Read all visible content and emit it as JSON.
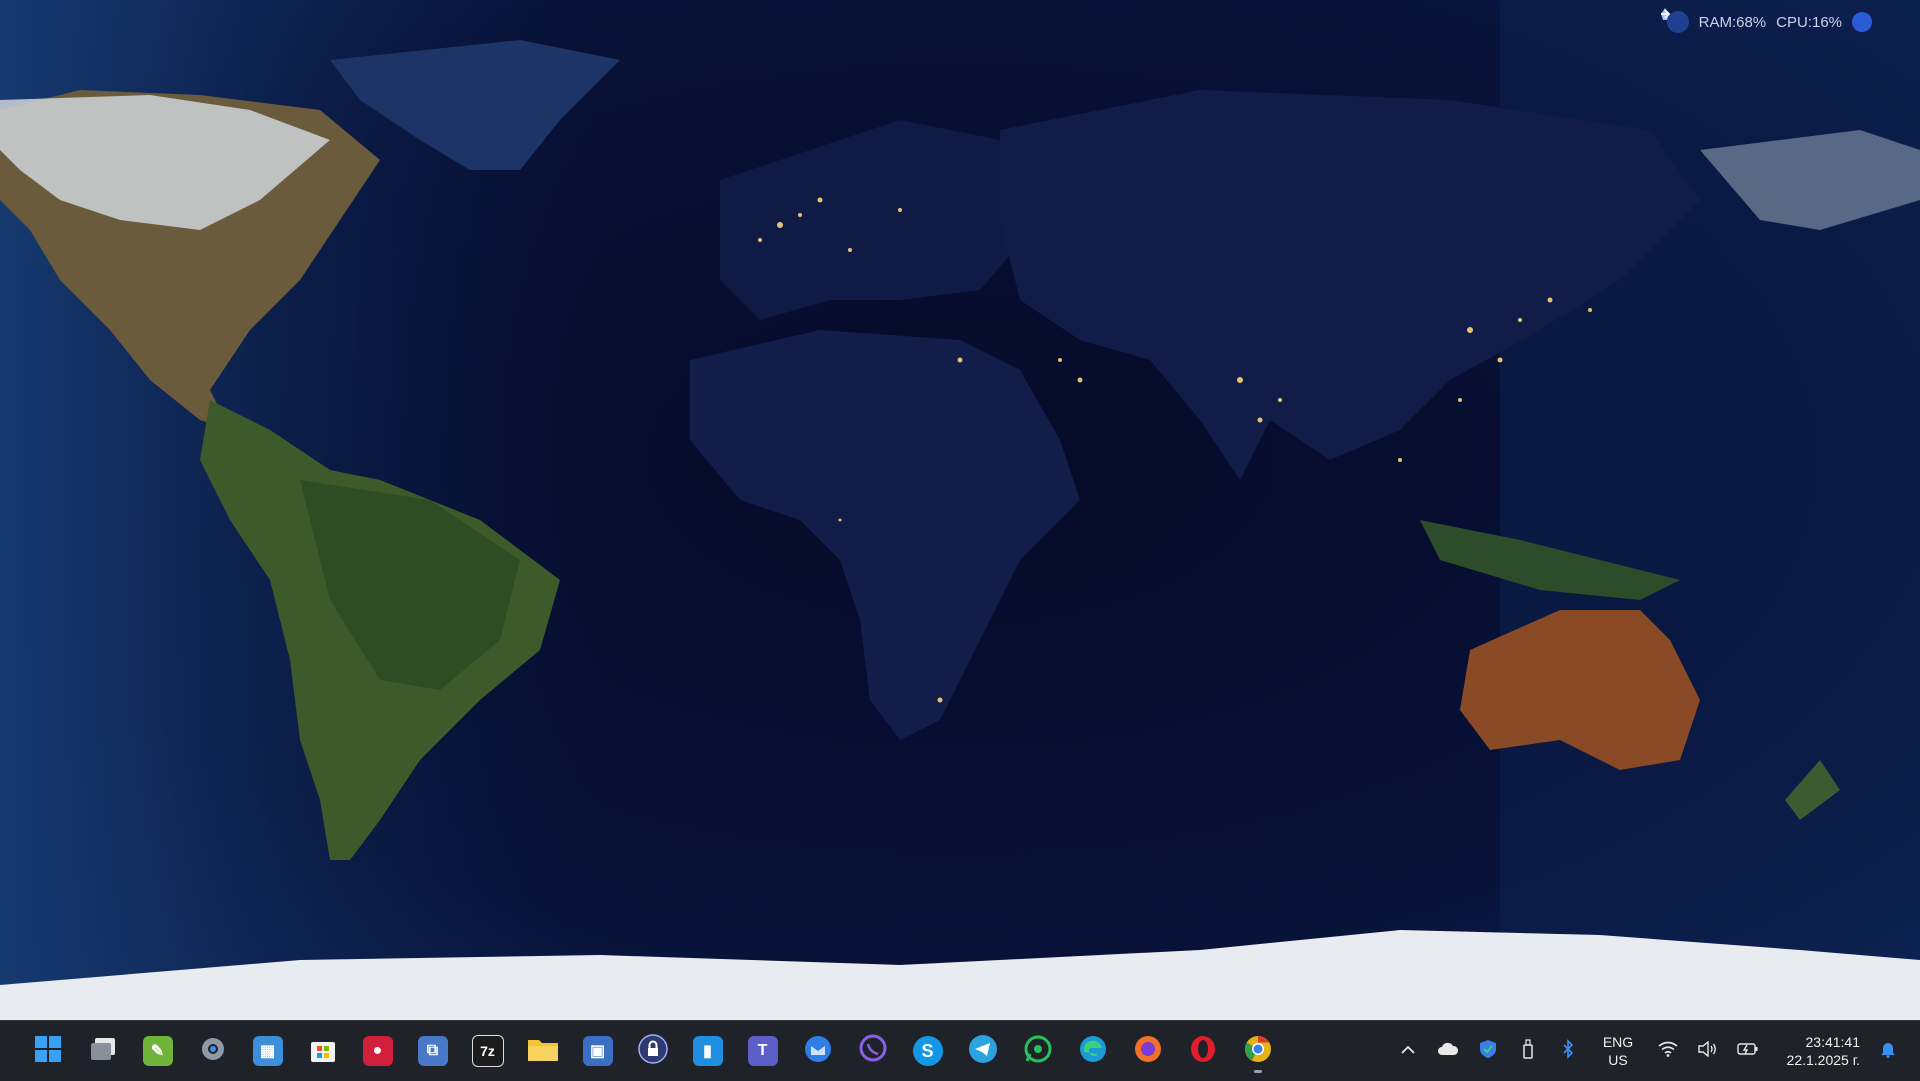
{
  "monitor": {
    "ram": "RAM:68%",
    "cpu": "CPU:16%"
  },
  "taskbar": {
    "apps": [
      {
        "name": "start",
        "color": "#2d8cf0"
      },
      {
        "name": "task-view",
        "color": "#9aa0aa"
      },
      {
        "name": "notepad-plus",
        "color": "#6fb33a"
      },
      {
        "name": "settings",
        "color": "#8f9aa8"
      },
      {
        "name": "control-panel",
        "color": "#3c8fd8"
      },
      {
        "name": "microsoft-store",
        "color": "#1f6fd2"
      },
      {
        "name": "screen-recorder",
        "color": "#d21f3c"
      },
      {
        "name": "network-tool",
        "color": "#4a78c8"
      },
      {
        "name": "7zip",
        "color": "#1b1b1b",
        "label": "7z"
      },
      {
        "name": "file-explorer",
        "color": "#f3c338"
      },
      {
        "name": "remote-desktop",
        "color": "#3a6fc4"
      },
      {
        "name": "password-manager",
        "color": "#4a6ed8"
      },
      {
        "name": "windows-app",
        "color": "#1f8ee0"
      },
      {
        "name": "teams",
        "color": "#5b5fc7"
      },
      {
        "name": "thunderbird",
        "color": "#2f7ee8"
      },
      {
        "name": "viber",
        "color": "#7b4fd6"
      },
      {
        "name": "skype",
        "color": "#1298e6",
        "label": "S"
      },
      {
        "name": "telegram",
        "color": "#2aa3e0"
      },
      {
        "name": "whatsapp",
        "color": "#25c15b"
      },
      {
        "name": "edge",
        "color": "#1a9bd8"
      },
      {
        "name": "firefox",
        "color": "#f2702a"
      },
      {
        "name": "opera",
        "color": "#e01d2b"
      },
      {
        "name": "chrome",
        "color": "#e6b21a"
      }
    ],
    "tray": {
      "lang_line1": "ENG",
      "lang_line2": "US",
      "time": "23:41:41",
      "date": "22.1.2025 г."
    }
  }
}
